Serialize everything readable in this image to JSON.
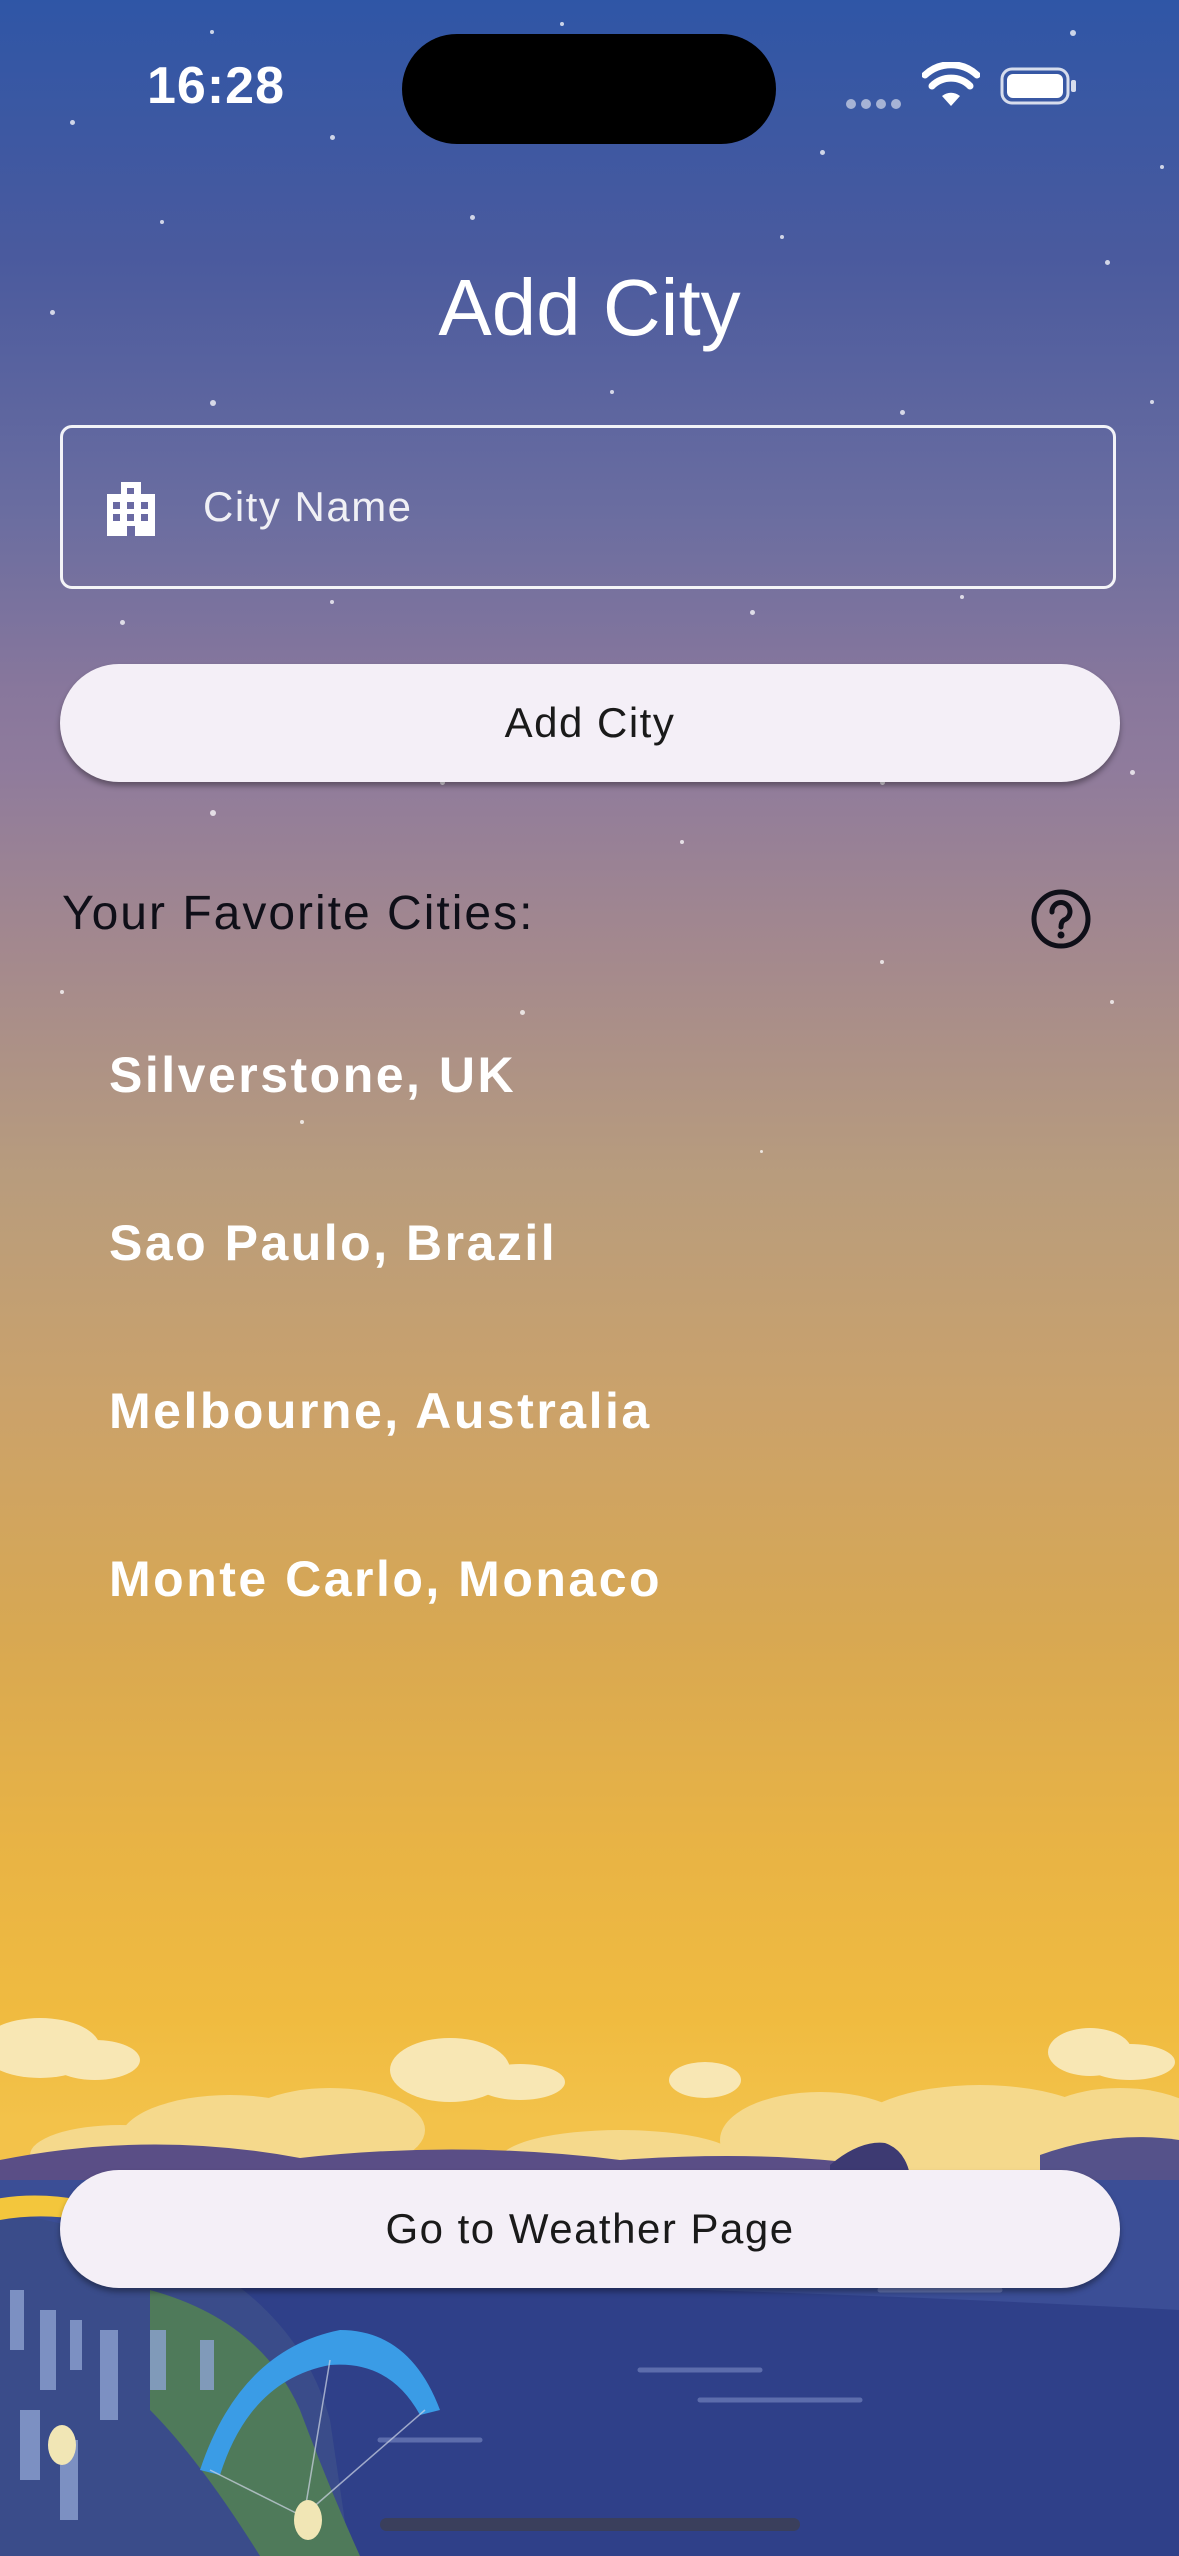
{
  "status_bar": {
    "time": "16:28"
  },
  "page": {
    "title": "Add City",
    "city_input": {
      "placeholder": "City Name",
      "value": ""
    },
    "add_button": "Add City",
    "favorites_header": "Your Favorite Cities:",
    "favorite_cities": [
      "Silverstone, UK",
      "Sao Paulo, Brazil",
      "Melbourne, Australia",
      "Monte Carlo, Monaco"
    ],
    "weather_button": "Go to Weather Page"
  },
  "icons": {
    "input_icon": "building-icon",
    "help_icon": "help-circle-icon",
    "wifi": "wifi-icon",
    "battery": "battery-icon"
  },
  "colors": {
    "sky_top": "#2f56a6",
    "sky_mid": "#8f7b9c",
    "sky_bottom": "#f0bb40",
    "button_bg": "#f4eff7",
    "header_text": "#0f0f18"
  }
}
